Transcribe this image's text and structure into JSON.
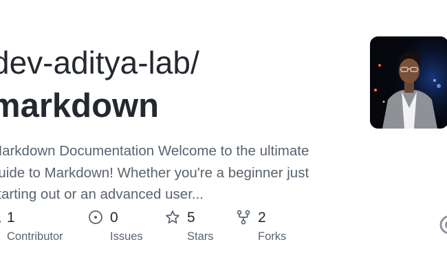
{
  "repo": {
    "owner": "dev-aditya-lab/",
    "name": "markdown",
    "description_lines": [
      "Markdown Documentation Welcome to the ultimate",
      "guide to Markdown! Whether you're a beginner just",
      "starting out or an advanced user..."
    ]
  },
  "stats": [
    {
      "value": "1",
      "label": "Contributor",
      "icon": "people-icon"
    },
    {
      "value": "0",
      "label": "Issues",
      "icon": "issue-opened-icon"
    },
    {
      "value": "5",
      "label": "Stars",
      "icon": "star-icon"
    },
    {
      "value": "2",
      "label": "Forks",
      "icon": "repo-forked-icon"
    }
  ],
  "colors": {
    "text_primary": "#24292f",
    "text_secondary": "#59636e",
    "background": "#ffffff"
  }
}
